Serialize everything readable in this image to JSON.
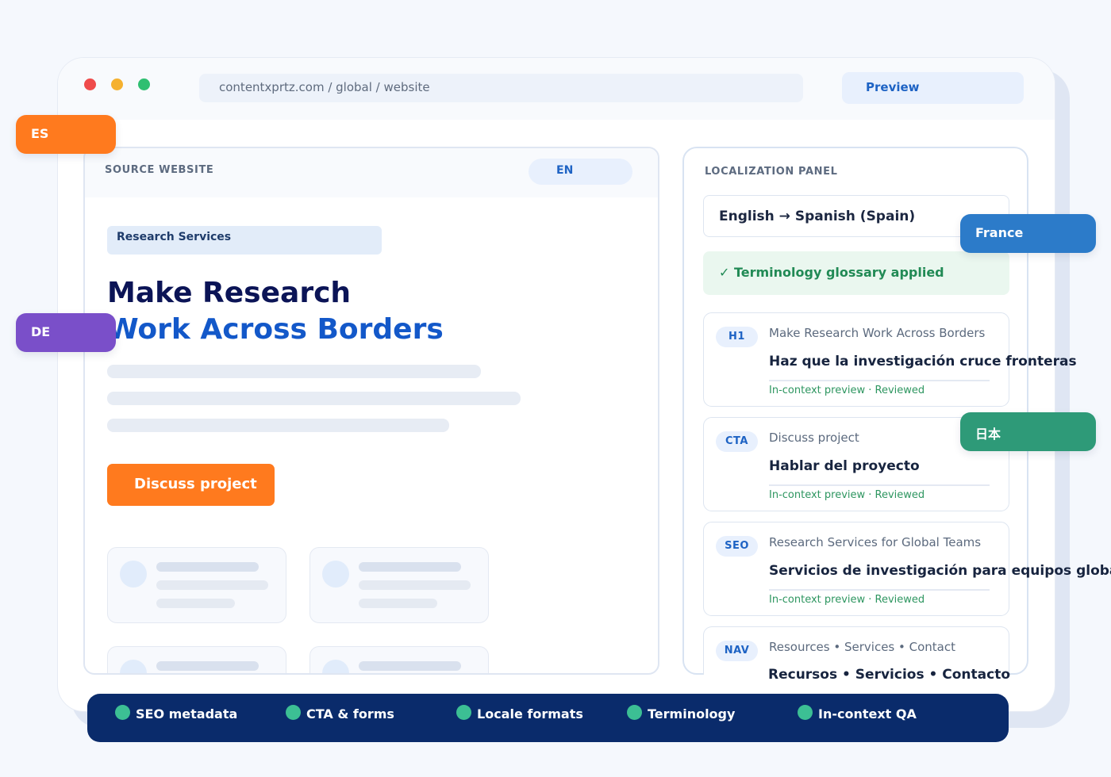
{
  "browser": {
    "url": "contentxprtz.com / global / website",
    "preview_label": "Preview",
    "dot_colors": [
      "#ef4b4b",
      "#f5b12f",
      "#2fbf71"
    ]
  },
  "source": {
    "heading": "SOURCE WEBSITE",
    "lang": "EN",
    "tag": "Research Services",
    "title_line1": "Make Research",
    "title_line2": "Work Across Borders",
    "cta": "Discuss project"
  },
  "localization": {
    "heading": "LOCALIZATION PANEL",
    "language_pair": "English  →  Spanish (Spain)",
    "glossary": "✓  Terminology glossary applied",
    "items": [
      {
        "badge": "H1",
        "source": "Make Research Work Across Borders",
        "target": "Haz que la investigación cruce fronteras",
        "status": "In-context preview · Reviewed"
      },
      {
        "badge": "CTA",
        "source": "Discuss project",
        "target": "Hablar del proyecto",
        "status": "In-context preview · Reviewed"
      },
      {
        "badge": "SEO",
        "source": "Research Services for Global Teams",
        "target": "Servicios de investigación para equipos globales",
        "status": "In-context preview · Reviewed"
      },
      {
        "badge": "NAV",
        "source": "Resources  •  Services  •  Contact",
        "target": "Recursos  •  Servicios  •  Contacto"
      }
    ]
  },
  "locale_tags": [
    {
      "label": "ES",
      "color": "#ff7a1e"
    },
    {
      "label": "DE",
      "color": "#7a4fc9"
    },
    {
      "label": "France",
      "color": "#2c7bc9"
    },
    {
      "label": "日本",
      "color": "#2e9a78"
    }
  ],
  "features": [
    "SEO metadata",
    "CTA & forms",
    "Locale formats",
    "Terminology",
    "In-context QA"
  ]
}
